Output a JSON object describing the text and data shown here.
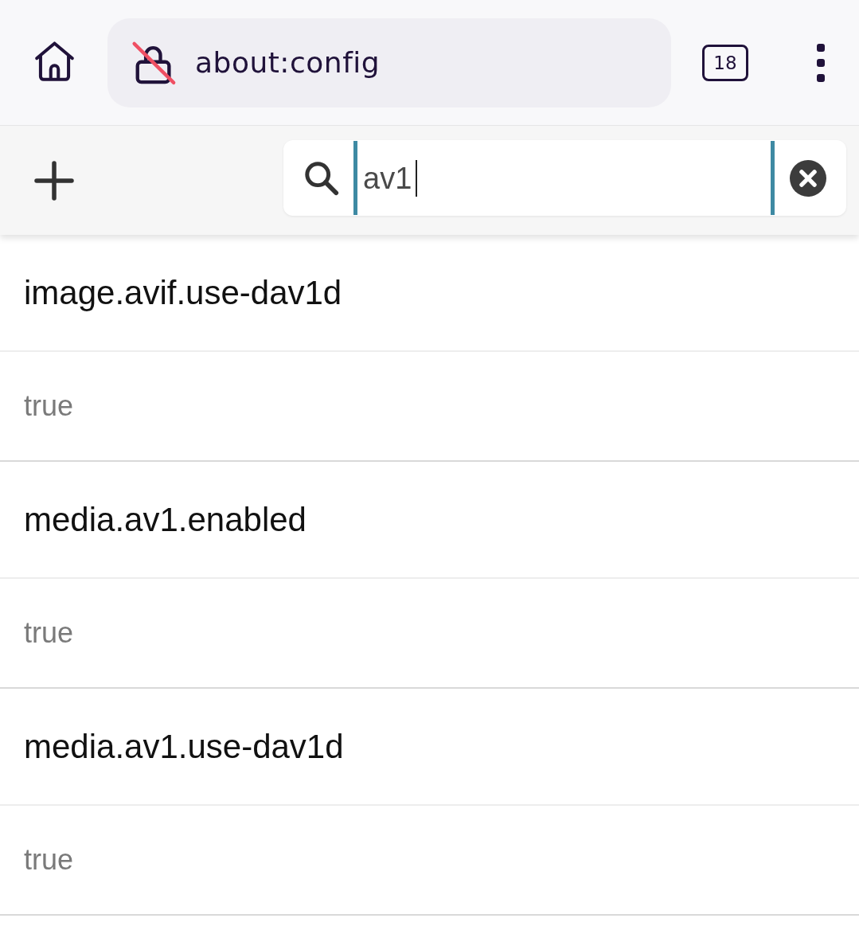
{
  "browser_toolbar": {
    "url": "about:config",
    "tab_count": "18"
  },
  "config_toolbar": {
    "search": {
      "value": "av1",
      "focused": true
    }
  },
  "preferences": [
    {
      "name": "image.avif.use-dav1d",
      "value": "true"
    },
    {
      "name": "media.av1.enabled",
      "value": "true"
    },
    {
      "name": "media.av1.use-dav1d",
      "value": "true"
    }
  ]
}
